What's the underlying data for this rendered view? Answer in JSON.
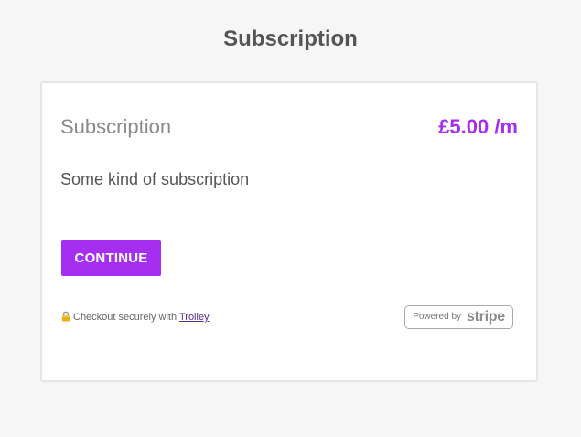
{
  "header": {
    "title": "Subscription"
  },
  "plan": {
    "name": "Subscription",
    "price": "£5.00 /m",
    "description": "Some kind of subscription"
  },
  "actions": {
    "continue_label": "CONTINUE"
  },
  "footer": {
    "secure_text": "Checkout securely with",
    "trolley_link": "Trolley",
    "lock_icon": "lock-icon",
    "stripe_badge": {
      "powered_by": "Powered by",
      "brand": "stripe"
    }
  },
  "colors": {
    "accent": "#a62ef0",
    "background": "#f6f6f6",
    "card": "#ffffff",
    "title_text": "#555555",
    "muted_text": "#8a8a8a",
    "link": "#5a2e8a"
  }
}
